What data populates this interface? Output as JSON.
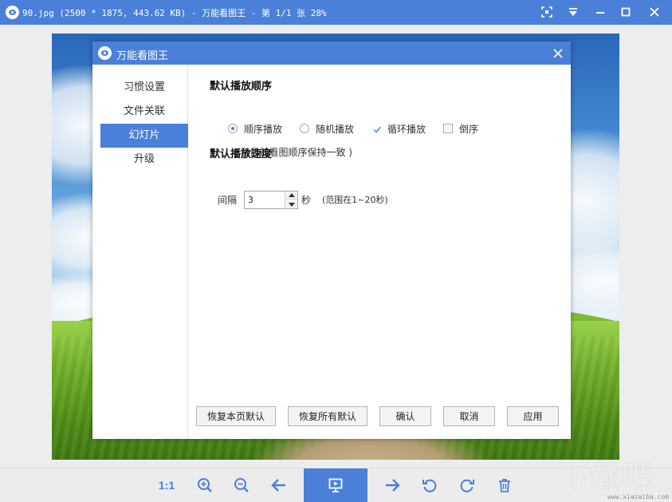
{
  "window": {
    "title": "90.jpg (2500 * 1875, 443.62 KB) - 万能看图王 - 第 1/1 张 28%",
    "buttons": [
      "fit-screen-icon",
      "dropdown-icon",
      "minimize-icon",
      "maximize-icon",
      "close-icon"
    ],
    "accent_color": "#4a80d8"
  },
  "dialog": {
    "title": "万能看图王",
    "sidebar": {
      "items": [
        {
          "label": "习惯设置",
          "active": false
        },
        {
          "label": "文件关联",
          "active": false
        },
        {
          "label": "幻灯片",
          "active": true
        },
        {
          "label": "升级",
          "active": false
        }
      ]
    },
    "order": {
      "title": "默认播放顺序",
      "options": [
        {
          "label": "顺序播放",
          "type": "radio",
          "checked": true
        },
        {
          "label": "随机播放",
          "type": "radio",
          "checked": false
        },
        {
          "label": "循环播放",
          "type": "checkbox",
          "checked": true
        },
        {
          "label": "倒序",
          "type": "checkbox",
          "checked": false
        }
      ],
      "note": "( 和目前看图顺序保持一致 )"
    },
    "speed": {
      "title": "默认播放速度",
      "interval_label": "间隔",
      "interval_value": "3",
      "unit": "秒",
      "range_hint": "(范围在1~20秒)"
    },
    "buttons": {
      "restore_page": "恢复本页默认",
      "restore_all": "恢复所有默认",
      "ok": "确认",
      "cancel": "取消",
      "apply": "应用"
    }
  },
  "toolbar": {
    "zoom_label": "1:1",
    "items": [
      "zoom-in-icon",
      "zoom-out-icon",
      "previous-icon",
      "slideshow-icon",
      "next-icon",
      "rotate-left-icon",
      "rotate-right-icon",
      "delete-icon"
    ]
  },
  "watermark": {
    "text": "下载吧",
    "sub": "www.xiazaiba.com"
  }
}
